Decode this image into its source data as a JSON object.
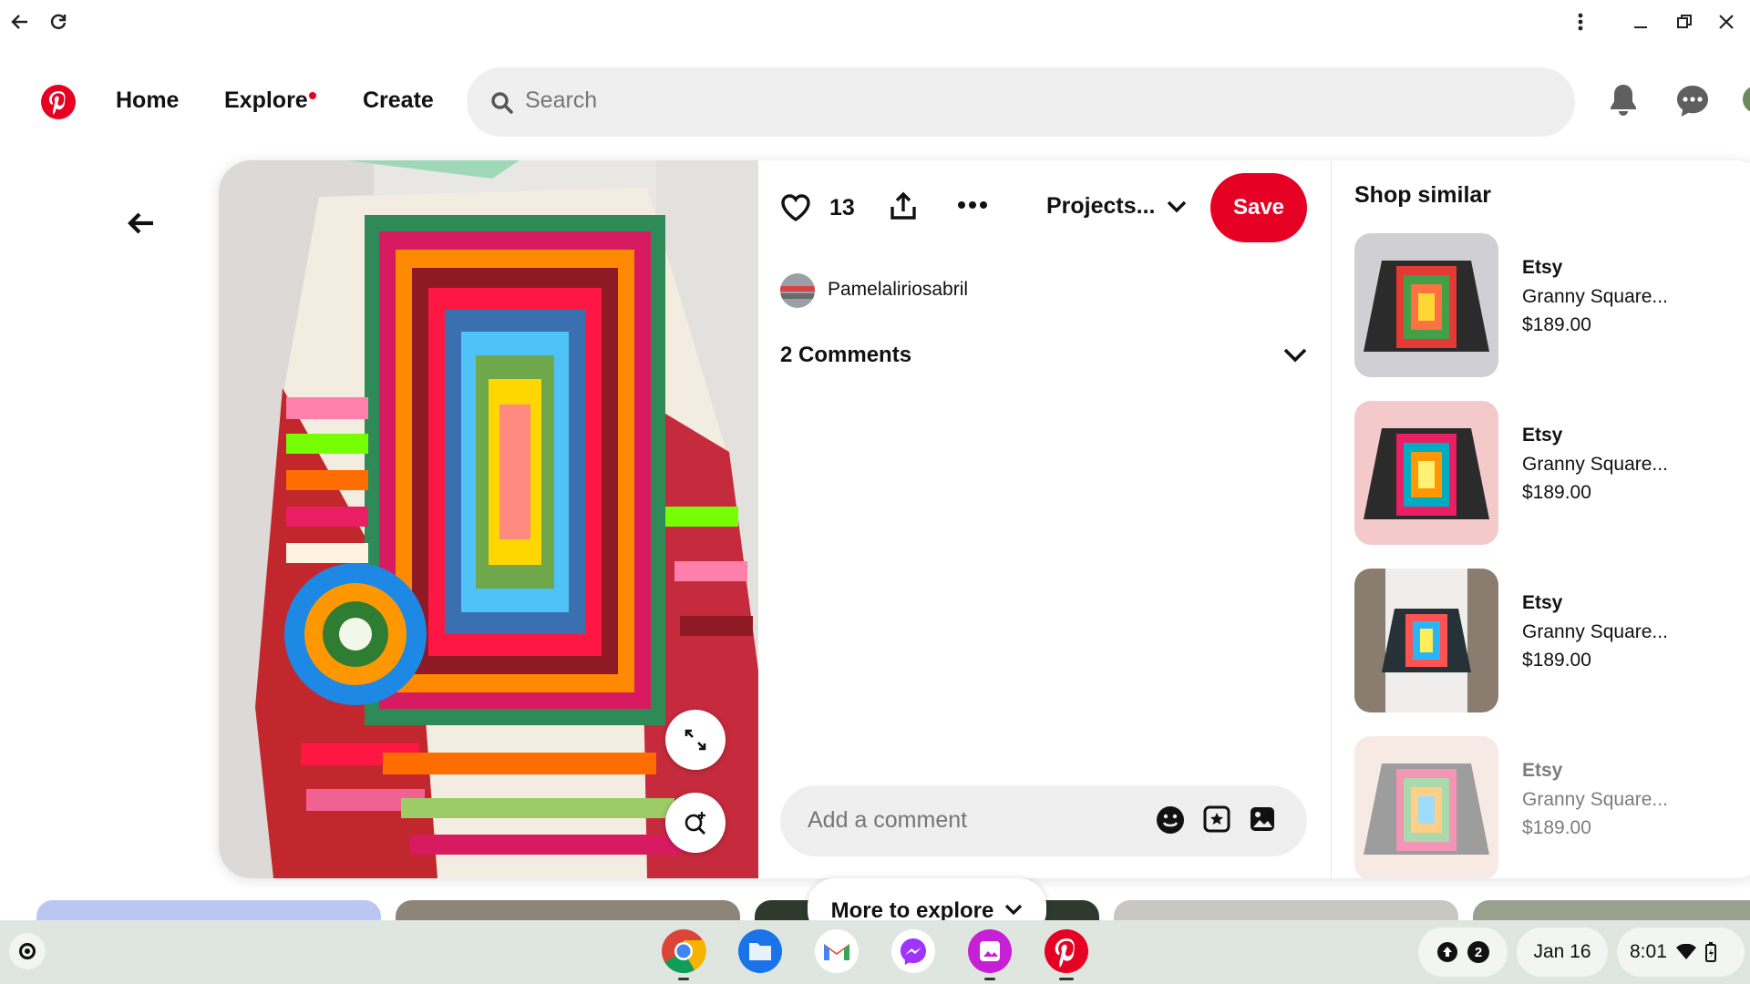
{
  "browser": {
    "back_icon": "arrow-left-icon",
    "reload_icon": "reload-icon",
    "menu_icon": "kebab-menu-icon",
    "minimize_icon": "minimize-icon",
    "restore_icon": "restore-icon",
    "close_icon": "close-icon"
  },
  "header": {
    "logo": "pinterest-logo",
    "nav": [
      {
        "label": "Home"
      },
      {
        "label": "Explore",
        "has_dot": true
      },
      {
        "label": "Create"
      }
    ],
    "search_placeholder": "Search",
    "brand_color": "#e60023"
  },
  "pin": {
    "like_count": "13",
    "board_label": "Projects...",
    "save_label": "Save",
    "author": "Pamelaliriosabril",
    "comments_label": "2 Comments",
    "comment_placeholder": "Add a comment"
  },
  "shop_similar": {
    "title": "Shop similar",
    "items": [
      {
        "store": "Etsy",
        "name": "Granny Square...",
        "price": "$189.00"
      },
      {
        "store": "Etsy",
        "name": "Granny Square...",
        "price": "$189.00"
      },
      {
        "store": "Etsy",
        "name": "Granny Square...",
        "price": "$189.00"
      },
      {
        "store": "Etsy",
        "name": "Granny Square...",
        "price": "$189.00"
      }
    ]
  },
  "more_to_explore": {
    "label": "More to explore"
  },
  "shelf": {
    "apps": [
      "chrome-icon",
      "files-icon",
      "gmail-icon",
      "messenger-icon",
      "gallery-icon",
      "pinterest-icon"
    ],
    "notification_count": "2",
    "date": "Jan 16",
    "time": "8:01"
  }
}
